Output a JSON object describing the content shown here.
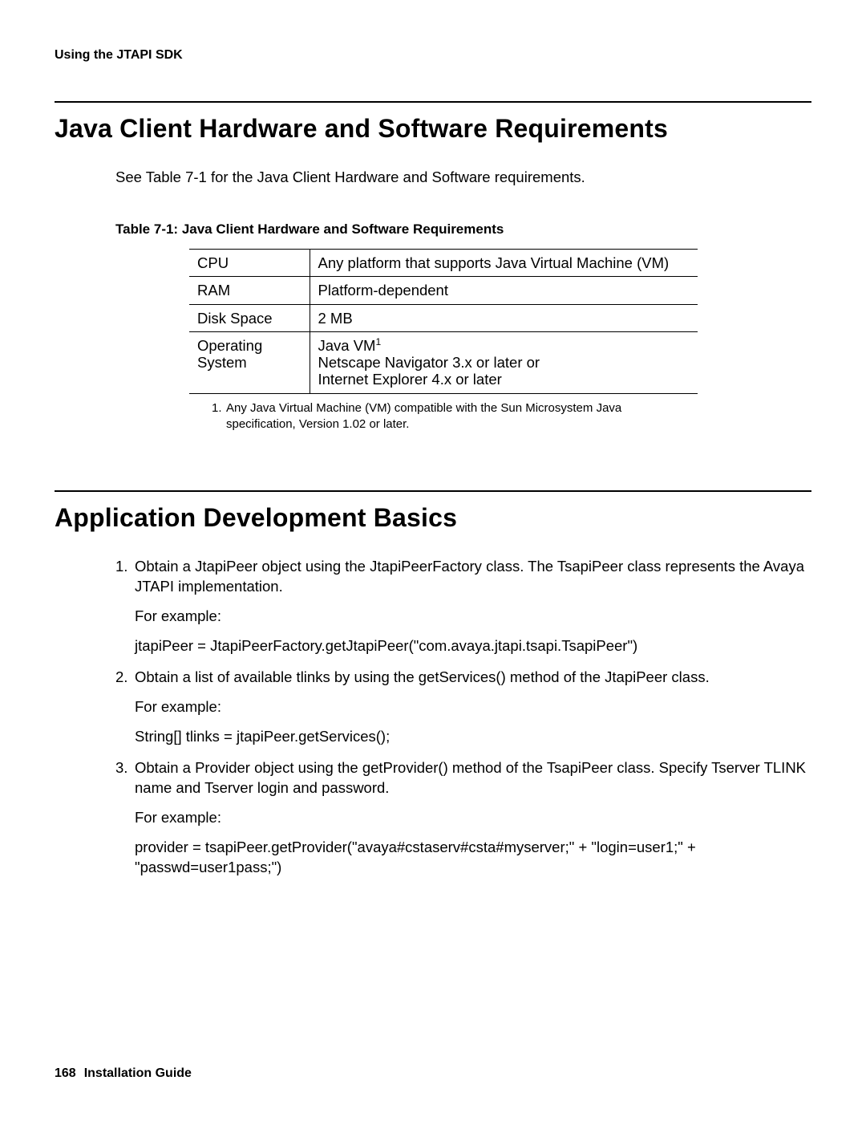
{
  "running_head": "Using the JTAPI SDK",
  "section1": {
    "title": "Java Client Hardware and Software Requirements",
    "intro": "See Table 7-1 for the Java Client Hardware and Software requirements.",
    "table_caption": "Table 7-1: Java Client Hardware and Software Requirements",
    "rows": [
      {
        "k": "CPU",
        "v": "Any platform that supports Java Virtual Machine (VM)"
      },
      {
        "k": "RAM",
        "v": "Platform-dependent"
      },
      {
        "k": "Disk Space",
        "v": "2 MB"
      },
      {
        "k": "Operating System",
        "v_line1_prefix": "Java VM",
        "v_line1_sup": "1",
        "v_line2": "Netscape Navigator 3.x or later or",
        "v_line3": "Internet Explorer 4.x or later"
      }
    ],
    "footnote_num": "1.",
    "footnote_text_l1": "Any Java Virtual Machine (VM) compatible with the Sun Microsystem Java",
    "footnote_text_l2": "specification, Version 1.02 or later."
  },
  "section2": {
    "title": "Application Development Basics",
    "steps": [
      {
        "num": "1.",
        "body": "Obtain a JtapiPeer object using the JtapiPeerFactory class. The TsapiPeer class represents the Avaya JTAPI implementation.",
        "eg_label": "For example:",
        "code": "jtapiPeer = JtapiPeerFactory.getJtapiPeer(\"com.avaya.jtapi.tsapi.TsapiPeer\")"
      },
      {
        "num": "2.",
        "body": "Obtain a list of available tlinks by using the getServices() method of the JtapiPeer class.",
        "eg_label": "For example:",
        "code": "String[] tlinks = jtapiPeer.getServices();"
      },
      {
        "num": "3.",
        "body": "Obtain a Provider object using the getProvider() method of the TsapiPeer class. Specify Tserver TLINK name and Tserver login and password.",
        "eg_label": "For example:",
        "code": "provider = tsapiPeer.getProvider(\"avaya#cstaserv#csta#myserver;\" + \"login=user1;\" + \"passwd=user1pass;\")"
      }
    ]
  },
  "footer": {
    "page": "168",
    "doc": "Installation Guide"
  }
}
